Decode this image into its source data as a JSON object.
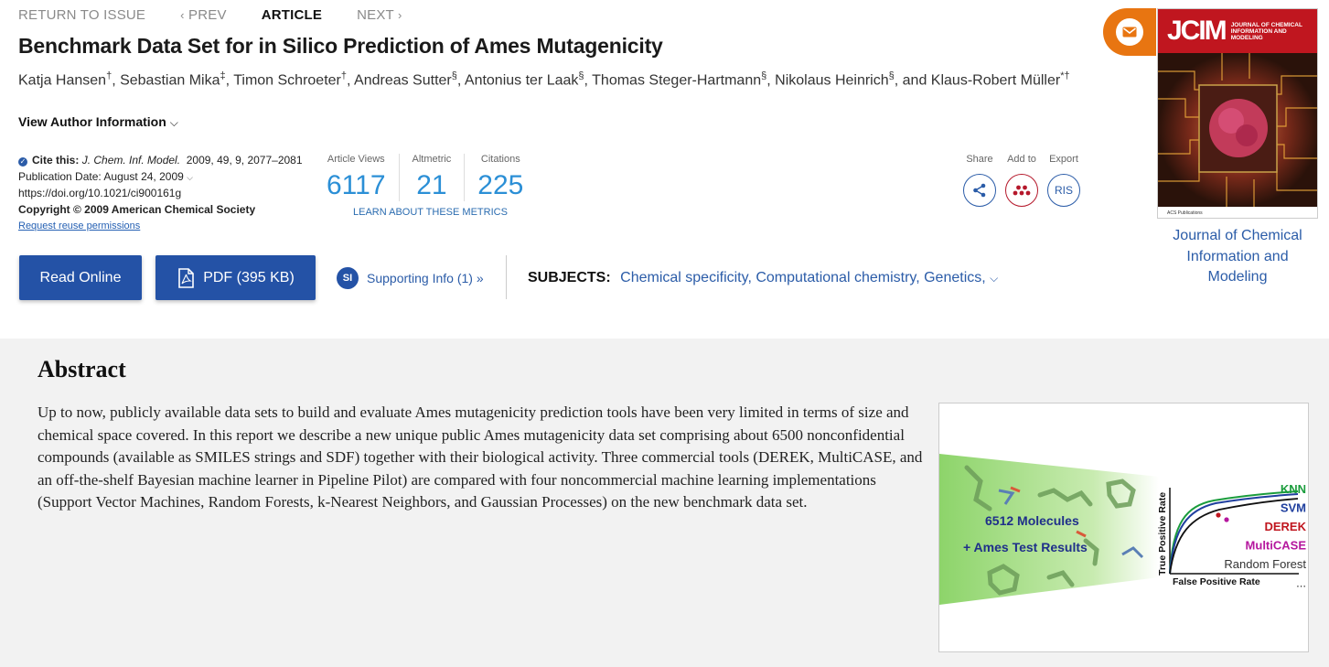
{
  "nav": {
    "return": "RETURN TO ISSUE",
    "prev": "PREV",
    "article": "ARTICLE",
    "next": "NEXT"
  },
  "title": "Benchmark Data Set for in Silico Prediction of Ames Mutagenicity",
  "authors": [
    {
      "name": "Katja Hansen",
      "mark": "†"
    },
    {
      "name": "Sebastian Mika",
      "mark": "‡"
    },
    {
      "name": "Timon Schroeter",
      "mark": "†"
    },
    {
      "name": "Andreas Sutter",
      "mark": "§"
    },
    {
      "name": "Antonius ter Laak",
      "mark": "§"
    },
    {
      "name": "Thomas Steger-Hartmann",
      "mark": "§"
    },
    {
      "name": "Nikolaus Heinrich",
      "mark": "§"
    },
    {
      "name": "Klaus-Robert Müller",
      "mark": "*†"
    }
  ],
  "authors_joiner": ", and ",
  "view_author": "View Author Information",
  "cite": {
    "label": "Cite this:",
    "journal": "J. Chem. Inf. Model.",
    "ref": "2009, 49, 9, 2077–2081",
    "pubdate": "Publication Date: August 24, 2009",
    "doi": "https://doi.org/10.1021/ci900161g",
    "copyright": "Copyright © 2009 American Chemical Society",
    "reuse": "Request reuse permissions"
  },
  "metrics": {
    "views_label": "Article Views",
    "views": "6117",
    "altmetric_label": "Altmetric",
    "altmetric": "21",
    "citations_label": "Citations",
    "citations": "225",
    "learn": "LEARN ABOUT THESE METRICS"
  },
  "actions": {
    "share": "Share",
    "add": "Add to",
    "export": "Export",
    "ris": "RIS"
  },
  "buttons": {
    "read": "Read Online",
    "pdf": "PDF (395 KB)"
  },
  "si": {
    "badge": "SI",
    "label": "Supporting Info (1) »"
  },
  "subjects": {
    "label": "SUBJECTS:",
    "values": "Chemical specificity, Computational chemistry, Genetics,"
  },
  "cover": {
    "logo": "JCIM",
    "journal_small": "JOURNAL OF CHEMICAL INFORMATION AND MODELING",
    "caption": "Journal of Chemical Information and Modeling",
    "publisher": "ACS Publications"
  },
  "abstract": {
    "heading": "Abstract",
    "text": "Up to now, publicly available data sets to build and evaluate Ames mutagenicity prediction tools have been very limited in terms of size and chemical space covered. In this report we describe a new unique public Ames mutagenicity data set comprising about 6500 nonconfidential compounds (available as SMILES strings and SDF) together with their biological activity. Three commercial tools (DEREK, MultiCASE, and an off-the-shelf Bayesian machine learner in Pipeline Pilot) are compared with four noncommercial machine learning implementations (Support Vector Machines, Random Forests, k-Nearest Neighbors, and Gaussian Processes) on the new benchmark data set."
  },
  "toc": {
    "line1": "6512 Molecules",
    "line2": "+ Ames Test Results",
    "ylabel": "True Positive Rate",
    "xlabel": "False Positive Rate",
    "legend": [
      {
        "label": "KNN",
        "color": "#1a9c3c"
      },
      {
        "label": "SVM",
        "color": "#1f3f9e"
      },
      {
        "label": "DEREK",
        "color": "#c0161f"
      },
      {
        "label": "MultiCASE",
        "color": "#b5179e"
      },
      {
        "label": "Random Forest",
        "color": "#333333"
      },
      {
        "label": "...",
        "color": "#333333"
      }
    ]
  },
  "colors": {
    "accent": "#2452a6",
    "metric": "#2b8fd6",
    "envelope": "#e87511",
    "cover": "#b7141d"
  }
}
